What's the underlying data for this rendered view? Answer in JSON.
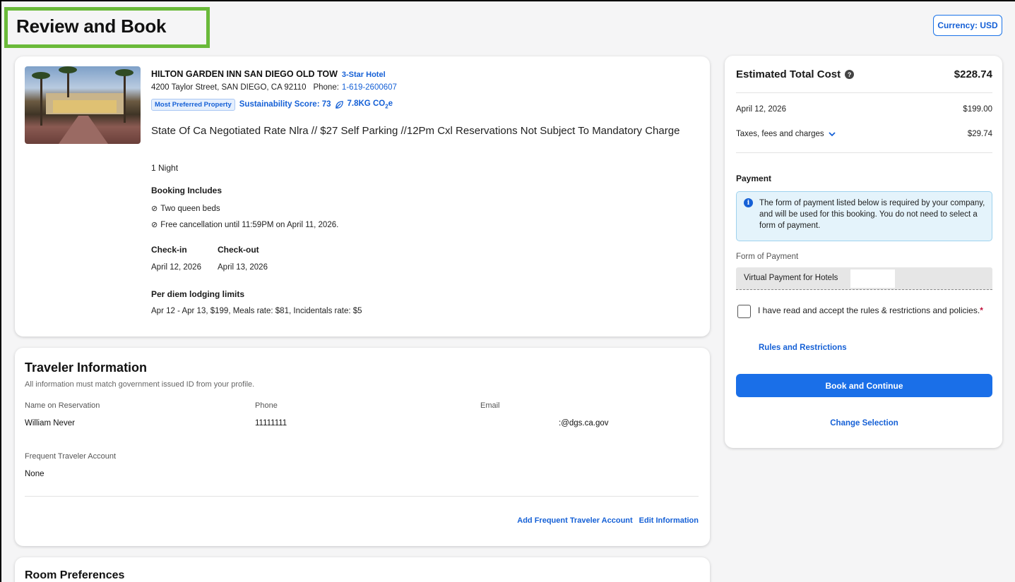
{
  "page": {
    "title": "Review and Book",
    "currency_label": "Currency: USD"
  },
  "hotel": {
    "name": "HILTON GARDEN INN SAN DIEGO OLD TOW",
    "star_rating": "3-Star Hotel",
    "address": "4200 Taylor Street, SAN DIEGO, CA 92110",
    "phone_label": "Phone:",
    "phone": "1-619-2600607",
    "preferred_badge": "Most Preferred Property",
    "sustainability": "Sustainability Score: 73",
    "co2_prefix": "7.8KG CO",
    "co2_sub": "2",
    "co2_suffix": "e",
    "rate_description": "State Of Ca Negotiated Rate Nlra // $27 Self Parking //12Pm Cxl Reservations Not Subject To Mandatory Charge",
    "nights": "1 Night",
    "includes_title": "Booking Includes",
    "includes": [
      "Two queen beds",
      "Free cancellation until 11:59PM on April 11, 2026."
    ],
    "checkin_label": "Check-in",
    "checkin_date": "April 12, 2026",
    "checkout_label": "Check-out",
    "checkout_date": "April 13, 2026",
    "per_diem_title": "Per diem lodging limits",
    "per_diem_text": "Apr 12 - Apr 13, $199, Meals rate: $81, Incidentals rate: $5"
  },
  "traveler": {
    "title": "Traveler Information",
    "subtitle": "All information must match government issued ID from your profile.",
    "name_label": "Name on Reservation",
    "name_value": "William Never",
    "phone_label": "Phone",
    "phone_value": "11111111",
    "email_label": "Email",
    "email_value": ":@dgs.ca.gov",
    "ftp_label": "Frequent Traveler Account",
    "ftp_value": "None",
    "add_ftp_link": "Add Frequent Traveler Account",
    "edit_link": "Edit Information"
  },
  "room": {
    "title": "Room Preferences"
  },
  "cost": {
    "title": "Estimated Total Cost",
    "total": "$228.74",
    "line1_label": "April 12, 2026",
    "line1_amount": "$199.00",
    "line2_label": "Taxes, fees and charges",
    "line2_amount": "$29.74",
    "payment_title": "Payment",
    "info_text": "The form of payment listed below is required by your company, and will be used for this booking. You do not need to select a form of payment.",
    "fop_label": "Form of Payment",
    "fop_value": "Virtual Payment for Hotels",
    "accept_text": "I have read and accept the rules & restrictions and policies.",
    "required_mark": "*",
    "rules_link": "Rules and Restrictions",
    "book_button": "Book and Continue",
    "change_link": "Change Selection"
  },
  "icons": {
    "help": "question-circle",
    "info": "info-circle",
    "chevron": "chevron-down",
    "leaf": "leaf",
    "check": "check-circle"
  },
  "colors": {
    "accent": "#1a6fe8",
    "link": "#1560d6",
    "title_highlight": "#6aba3a"
  }
}
